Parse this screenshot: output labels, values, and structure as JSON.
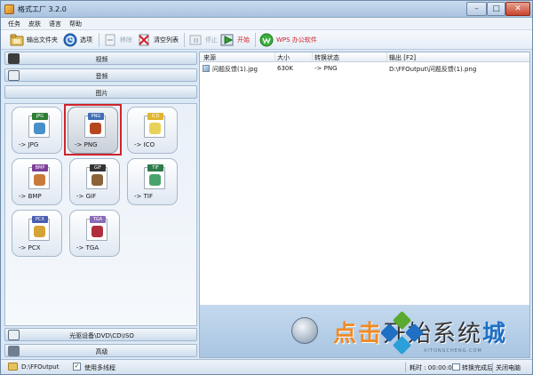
{
  "window": {
    "title": "格式工厂 3.2.0",
    "controls": {
      "minimize": "–",
      "maximize": "□",
      "close": "✕"
    }
  },
  "menu": [
    "任务",
    "皮肤",
    "语言",
    "帮助"
  ],
  "toolbar": {
    "output_folder": "输出文件夹",
    "options": "选项",
    "remove": "移除",
    "clear_list": "清空列表",
    "stop": "停止",
    "start": "开始",
    "wps": "WPS 办公软件"
  },
  "categories": {
    "video": "视频",
    "audio": "音频",
    "image": "图片",
    "rom": "光驱设备\\DVD\\CD\\ISO",
    "advanced": "高级"
  },
  "formats": [
    {
      "tag": "JPG",
      "label": "-> JPG",
      "tag_color": "#2e7d32",
      "art_color": "#4a90c8"
    },
    {
      "tag": "PNG",
      "label": "-> PNG",
      "tag_color": "#3f6fb5",
      "art_color": "#b5471f",
      "selected": true
    },
    {
      "tag": "ICO",
      "label": "-> ICO",
      "tag_color": "#e0b52d",
      "art_color": "#e8d25a"
    },
    {
      "tag": "BMP",
      "label": "-> BMP",
      "tag_color": "#7b3f98",
      "art_color": "#c97a3a"
    },
    {
      "tag": "GIF",
      "label": "-> GIF",
      "tag_color": "#333333",
      "art_color": "#8c6239"
    },
    {
      "tag": "TIF",
      "label": "-> TIF",
      "tag_color": "#2d7a4a",
      "art_color": "#4aa36b"
    },
    {
      "tag": "PCX",
      "label": "-> PCX",
      "tag_color": "#4a5fb0",
      "art_color": "#d4a437"
    },
    {
      "tag": "TGA",
      "label": "-> TGA",
      "tag_color": "#8a6bb8",
      "art_color": "#b02f3f"
    }
  ],
  "list": {
    "headers": {
      "source": "来源",
      "size": "大小",
      "status": "转换状态",
      "output": "输出 [F2]"
    },
    "rows": [
      {
        "source": "问题反馈(1).jpg",
        "size": "630K",
        "status": "-> PNG",
        "output": "D:\\FFOutput\\问题反馈(1).png"
      }
    ]
  },
  "watermark": {
    "part1": "点击",
    "part2": "开始",
    "part3": "系统",
    "part4": "城",
    "domain": "XITONGCHENG.COM"
  },
  "status": {
    "output_path": "D:\\FFOutput",
    "multithread_checkbox": "✓",
    "multithread": "使用多线程",
    "elapsed": "耗时 : 00:00:00",
    "after_convert": "转换完成后",
    "shutdown": "关闭电脑"
  },
  "colors": {
    "accent_red": "#d0242b",
    "start_green": "#2f9e2f",
    "title_gradient": "#a9c3df",
    "watermark_orange": "#f08a24",
    "watermark_blue": "#1f6fc3"
  }
}
